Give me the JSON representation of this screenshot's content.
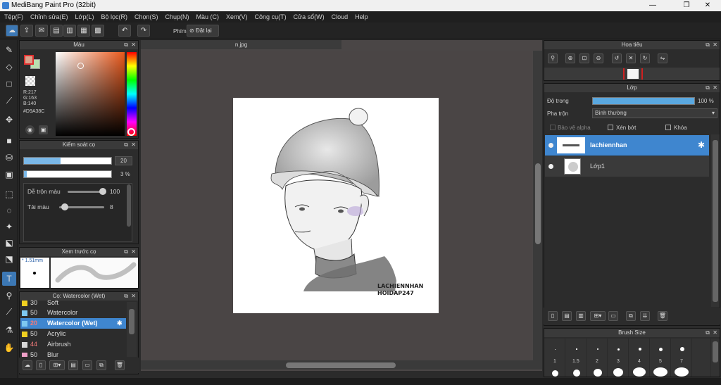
{
  "window": {
    "title": "MediBang Paint Pro (32bit)",
    "minimize": "—",
    "restore": "❐",
    "close": "✕"
  },
  "menu": [
    "Tệp(F)",
    "Chỉnh sửa(E)",
    "Lớp(L)",
    "Bộ lọc(R)",
    "Chọn(S)",
    "Chụp(N)",
    "Màu (C)",
    "Xem(V)",
    "Công cụ(T)",
    "Cửa sổ(W)",
    "Cloud",
    "Help"
  ],
  "toolbar": {
    "snap_label": "Phím",
    "reset_label": "Đặt lại"
  },
  "color_panel": {
    "title": "Màu",
    "readout_r": "R:217",
    "readout_g": "G:163",
    "readout_b": "B:140",
    "hex": "#D9A38C",
    "primary_color": "#D9A38C",
    "secondary_color": "#b8e0b0"
  },
  "brush_control": {
    "title": "Kiểm soát cọ",
    "size_value": "20",
    "opacity_value": "3 %",
    "mix_label": "Dễ trộn màu",
    "mix_value": "100",
    "load_label": "Tải màu",
    "load_value": "8"
  },
  "preview": {
    "title": "Xem trước cọ",
    "size": "* 1.51mm"
  },
  "brush_list": {
    "title": "Cọ: Watercolor (Wet)",
    "items": [
      {
        "num": "30",
        "name": "Soft",
        "color": "#f0d020"
      },
      {
        "num": "50",
        "name": "Watercolor",
        "color": "#7ec8f0"
      },
      {
        "num": "20",
        "name": "Watercolor (Wet)",
        "color": "#7ec8f0"
      },
      {
        "num": "50",
        "name": "Acrylic",
        "color": "#f0d020"
      },
      {
        "num": "44",
        "name": "Airbrush",
        "color": "#d8d8d8"
      },
      {
        "num": "50",
        "name": "Blur",
        "color": "#f0a0c8"
      }
    ]
  },
  "canvas": {
    "tab": "n.jpg",
    "signature_line1": "LACHIENNHAN",
    "signature_line2": "HOIDAP247"
  },
  "navigator": {
    "title": "Hoa tiêu"
  },
  "layers": {
    "title": "Lớp",
    "opacity_label": "Độ trong",
    "opacity_value": "100 %",
    "opacity_fraction": 1.0,
    "blend_label": "Pha trộn",
    "blend_value": "Bình thường",
    "protect_alpha": "Bảo vệ alpha",
    "clipping": "Xén bớt",
    "lock": "Khóa",
    "items": [
      {
        "name": "lachiennhan",
        "selected": true
      },
      {
        "name": "Lớp1",
        "selected": false
      }
    ]
  },
  "brush_size": {
    "title": "Brush Size",
    "labels": [
      "1",
      "1.5",
      "2",
      "3",
      "4",
      "5",
      "7"
    ]
  }
}
